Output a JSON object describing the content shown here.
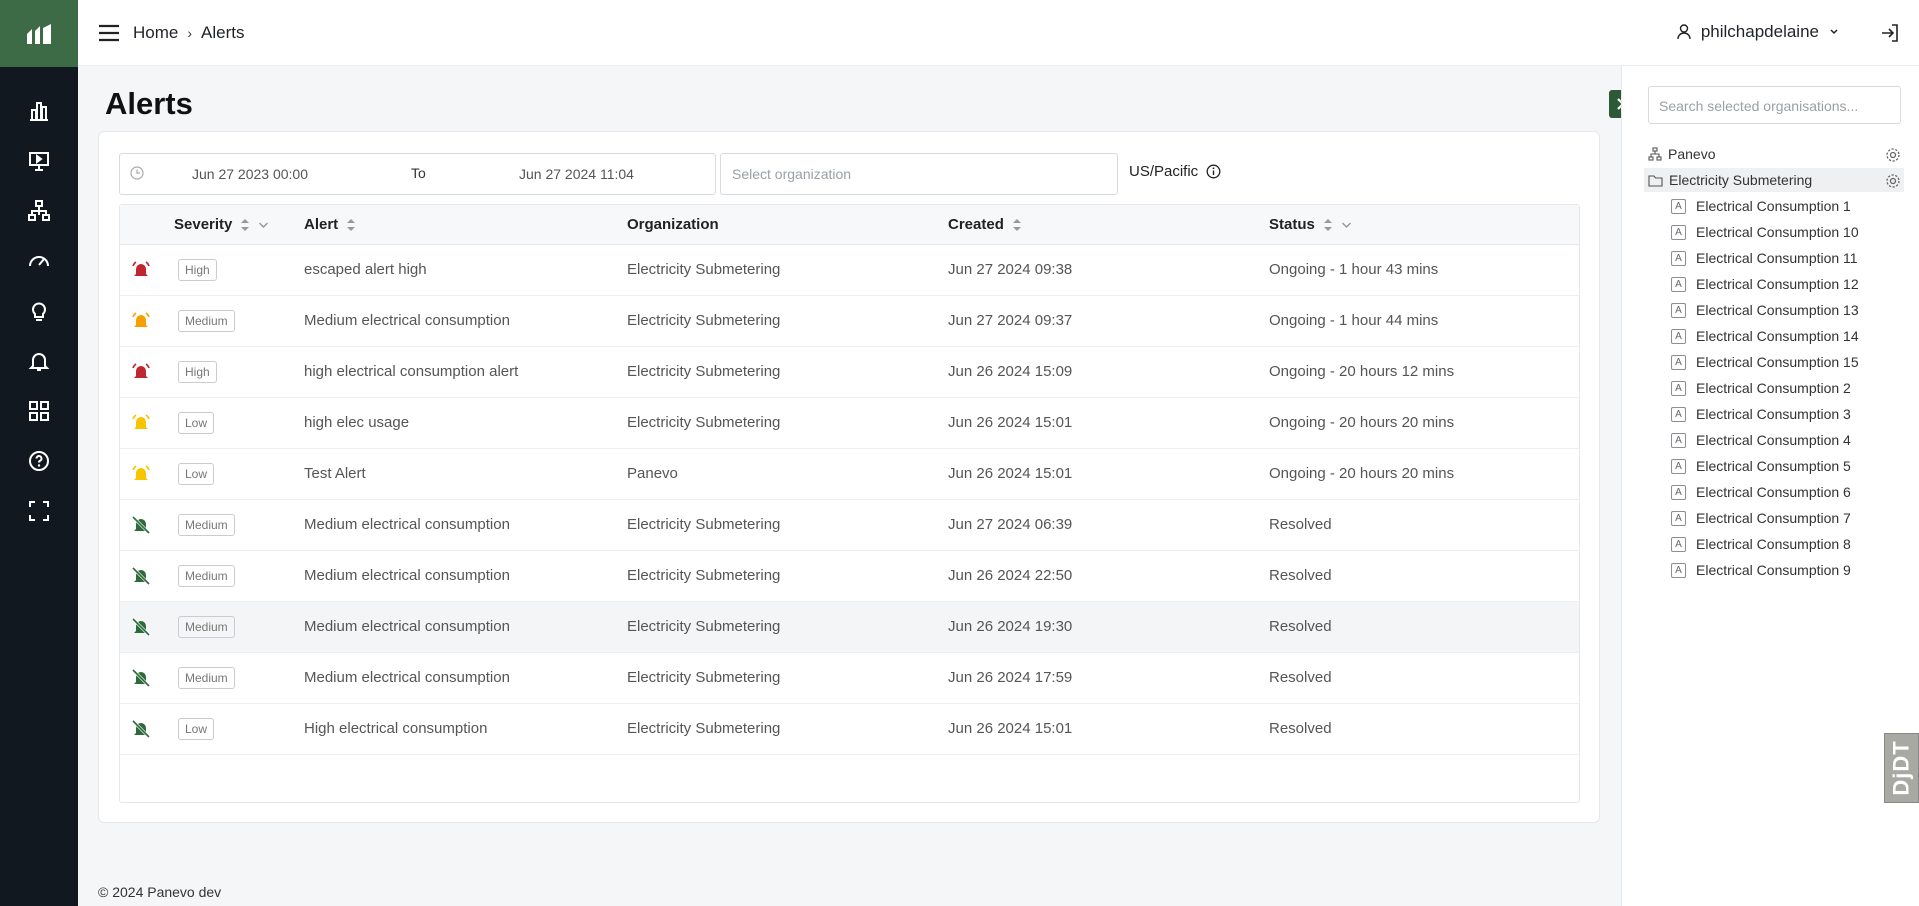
{
  "colors": {
    "brand": "#3d6b45",
    "rail": "#111820",
    "critical": "#c0262d",
    "warning": "#f5a000",
    "resolved": "#2e6b3a"
  },
  "breadcrumb": {
    "home": "Home",
    "current": "Alerts"
  },
  "user": {
    "name": "philchapdelaine"
  },
  "page": {
    "title": "Alerts"
  },
  "filters": {
    "from": "Jun 27 2023 00:00",
    "to_label": "To",
    "until": "Jun 27 2024 11:04",
    "org_placeholder": "Select organization",
    "timezone": "US/Pacific"
  },
  "table": {
    "headers": {
      "severity": "Severity",
      "alert": "Alert",
      "organization": "Organization",
      "created": "Created",
      "status": "Status"
    },
    "rows": [
      {
        "icon": "bell-ringing-red-icon",
        "severity": "High",
        "alert": "escaped alert high",
        "organization": "Electricity Submetering",
        "created": "Jun 27 2024 09:38",
        "status": "Ongoing - 1 hour 43 mins"
      },
      {
        "icon": "bell-ringing-orange-icon",
        "severity": "Medium",
        "alert": "Medium electrical consumption",
        "organization": "Electricity Submetering",
        "created": "Jun 27 2024 09:37",
        "status": "Ongoing - 1 hour 44 mins"
      },
      {
        "icon": "bell-ringing-red-icon",
        "severity": "High",
        "alert": "high electrical consumption alert",
        "organization": "Electricity Submetering",
        "created": "Jun 26 2024 15:09",
        "status": "Ongoing - 20 hours 12 mins"
      },
      {
        "icon": "bell-ringing-yellow-icon",
        "severity": "Low",
        "alert": "high elec usage",
        "organization": "Electricity Submetering",
        "created": "Jun 26 2024 15:01",
        "status": "Ongoing - 20 hours 20 mins"
      },
      {
        "icon": "bell-ringing-yellow-icon",
        "severity": "Low",
        "alert": "Test Alert",
        "organization": "Panevo",
        "created": "Jun 26 2024 15:01",
        "status": "Ongoing - 20 hours 20 mins"
      },
      {
        "icon": "bell-off-icon",
        "severity": "Medium",
        "alert": "Medium electrical consumption",
        "organization": "Electricity Submetering",
        "created": "Jun 27 2024 06:39",
        "status": "Resolved"
      },
      {
        "icon": "bell-off-icon",
        "severity": "Medium",
        "alert": "Medium electrical consumption",
        "organization": "Electricity Submetering",
        "created": "Jun 26 2024 22:50",
        "status": "Resolved"
      },
      {
        "icon": "bell-off-icon",
        "severity": "Medium",
        "alert": "Medium electrical consumption",
        "organization": "Electricity Submetering",
        "created": "Jun 26 2024 19:30",
        "status": "Resolved"
      },
      {
        "icon": "bell-off-icon",
        "severity": "Medium",
        "alert": "Medium electrical consumption",
        "organization": "Electricity Submetering",
        "created": "Jun 26 2024 17:59",
        "status": "Resolved"
      },
      {
        "icon": "bell-off-icon",
        "severity": "Low",
        "alert": "High electrical consumption",
        "organization": "Electricity Submetering",
        "created": "Jun 26 2024 15:01",
        "status": "Resolved"
      }
    ]
  },
  "footer": {
    "text": "© 2024 Panevo dev"
  },
  "org_panel": {
    "search_placeholder": "Search selected organisations...",
    "root": "Panevo",
    "selected": "Electricity Submetering",
    "leaf_badge": "A",
    "assets": [
      "Electrical Consumption 1",
      "Electrical Consumption 10",
      "Electrical Consumption 11",
      "Electrical Consumption 12",
      "Electrical Consumption 13",
      "Electrical Consumption 14",
      "Electrical Consumption 15",
      "Electrical Consumption 2",
      "Electrical Consumption 3",
      "Electrical Consumption 4",
      "Electrical Consumption 5",
      "Electrical Consumption 6",
      "Electrical Consumption 7",
      "Electrical Consumption 8",
      "Electrical Consumption 9"
    ]
  },
  "watermark": {
    "text": "DjDT"
  }
}
